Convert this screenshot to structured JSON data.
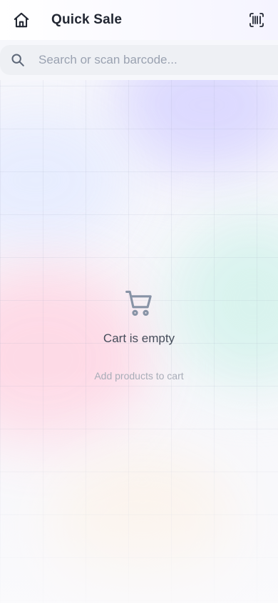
{
  "header": {
    "title": "Quick Sale",
    "home_icon": "home-icon",
    "barcode_icon": "barcode-icon"
  },
  "search": {
    "placeholder": "Search or scan barcode...",
    "value": "",
    "icon": "search-icon"
  },
  "cart": {
    "icon": "cart-icon",
    "empty_title": "Cart is empty",
    "empty_subtitle": "Add products to cart"
  },
  "colors": {
    "title_text": "#222733",
    "icon": "#222733",
    "search_bg": "#eef0f4",
    "cart_icon": "#8893a6",
    "muted_text": "#a8adb8"
  }
}
